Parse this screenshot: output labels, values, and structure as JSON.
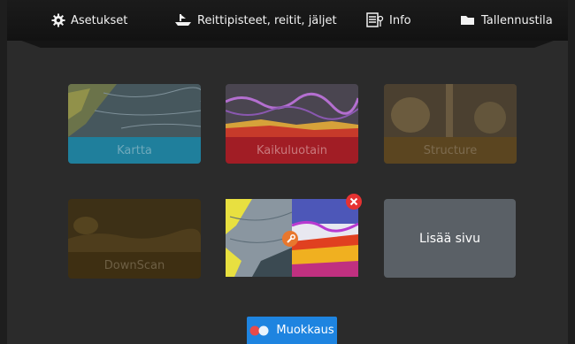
{
  "top_menu": {
    "settings_label": "Asetukset",
    "waypoints_label": "Reittipisteet, reitit, jäljet",
    "info_label": "Info",
    "storage_label": "Tallennustila"
  },
  "tiles": {
    "chart_label": "Kartta",
    "sonar_label": "Kaikuluotain",
    "structure_label": "Structure",
    "downscan_label": "DownScan",
    "add_page_label": "Lisää sivu"
  },
  "edit_button_label": "Muokkaus",
  "colors": {
    "chart_caption": "#1f7f9c",
    "sonar_caption": "#a11d25",
    "structure_caption": "#5b4520",
    "downscan_caption": "#3e2f12",
    "add_tile": "#5a6066",
    "edit_button": "#1e84e0",
    "close_badge": "#e63232",
    "wrench_badge": "#e8772e"
  },
  "icons": {
    "settings": "gear-icon",
    "waypoints": "boat-icon",
    "info": "info-icon",
    "storage": "folder-icon",
    "remove": "close-icon",
    "configure": "wrench-icon",
    "edit": "toggle-icon"
  }
}
